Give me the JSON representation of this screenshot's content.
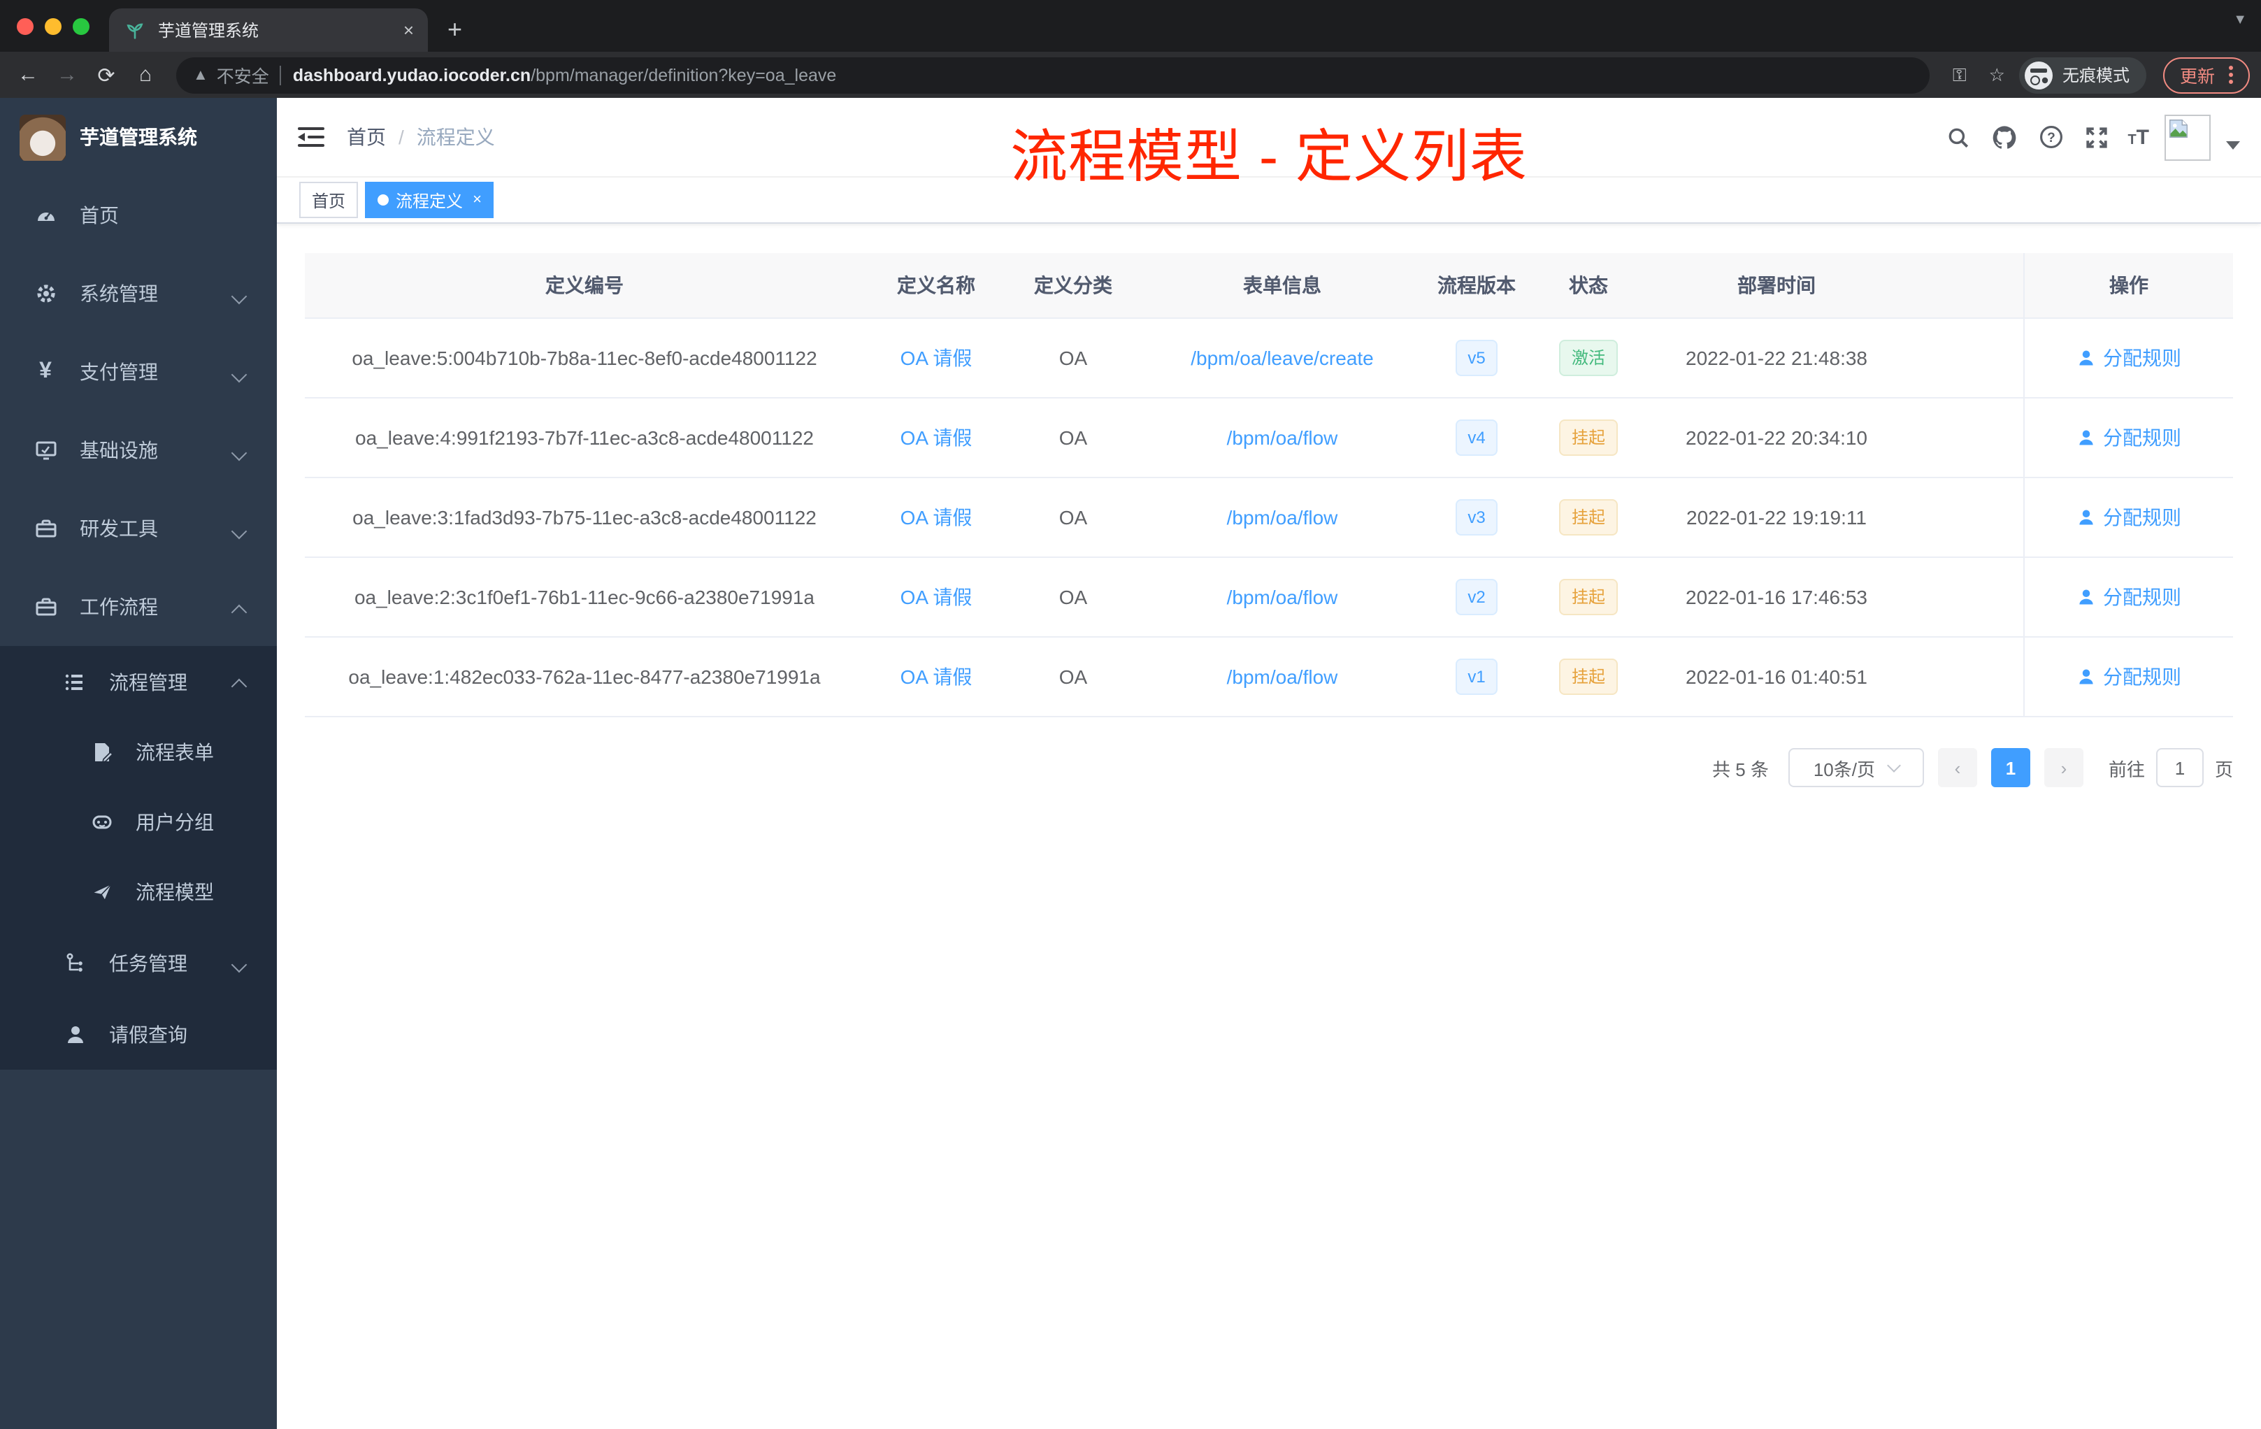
{
  "browser": {
    "tab": {
      "title": "芋道管理系统",
      "close": "×",
      "new_tab": "+"
    },
    "address": {
      "not_secure": "不安全",
      "domain": "dashboard.yudao.iocoder.cn",
      "path": "/bpm/manager/definition?key=oa_leave"
    },
    "incognito_label": "无痕模式",
    "update_label": "更新"
  },
  "sidebar": {
    "logo_title": "芋道管理系统",
    "menu": [
      {
        "label": "首页",
        "icon": "dashboard"
      },
      {
        "label": "系统管理",
        "icon": "gear"
      },
      {
        "label": "支付管理",
        "icon": "yen"
      },
      {
        "label": "基础设施",
        "icon": "monitor"
      },
      {
        "label": "研发工具",
        "icon": "toolbox"
      },
      {
        "label": "工作流程",
        "icon": "toolbox"
      }
    ],
    "workflow_submenu": [
      {
        "label": "流程管理",
        "icon": "list"
      },
      {
        "label": "流程表单",
        "icon": "form"
      },
      {
        "label": "用户分组",
        "icon": "robot"
      },
      {
        "label": "流程模型",
        "icon": "send"
      },
      {
        "label": "任务管理",
        "icon": "tree"
      },
      {
        "label": "请假查询",
        "icon": "user"
      }
    ]
  },
  "header": {
    "breadcrumb_home": "首页",
    "breadcrumb_sep": "/",
    "breadcrumb_current": "流程定义",
    "annotation": "流程模型 - 定义列表"
  },
  "tags": {
    "home": "首页",
    "active": "流程定义",
    "close": "×"
  },
  "table": {
    "columns": [
      "定义编号",
      "定义名称",
      "定义分类",
      "表单信息",
      "流程版本",
      "状态",
      "部署时间",
      "操作"
    ],
    "rows": [
      {
        "id": "oa_leave:5:004b710b-7b8a-11ec-8ef0-acde48001122",
        "name": "OA 请假",
        "category": "OA",
        "form": "/bpm/oa/leave/create",
        "version": "v5",
        "status": "激活",
        "time": "2022-01-22 21:48:38",
        "action": "分配规则"
      },
      {
        "id": "oa_leave:4:991f2193-7b7f-11ec-a3c8-acde48001122",
        "name": "OA 请假",
        "category": "OA",
        "form": "/bpm/oa/flow",
        "version": "v4",
        "status": "挂起",
        "time": "2022-01-22 20:34:10",
        "action": "分配规则"
      },
      {
        "id": "oa_leave:3:1fad3d93-7b75-11ec-a3c8-acde48001122",
        "name": "OA 请假",
        "category": "OA",
        "form": "/bpm/oa/flow",
        "version": "v3",
        "status": "挂起",
        "time": "2022-01-22 19:19:11",
        "action": "分配规则"
      },
      {
        "id": "oa_leave:2:3c1f0ef1-76b1-11ec-9c66-a2380e71991a",
        "name": "OA 请假",
        "category": "OA",
        "form": "/bpm/oa/flow",
        "version": "v2",
        "status": "挂起",
        "time": "2022-01-16 17:46:53",
        "action": "分配规则"
      },
      {
        "id": "oa_leave:1:482ec033-762a-11ec-8477-a2380e71991a",
        "name": "OA 请假",
        "category": "OA",
        "form": "/bpm/oa/flow",
        "version": "v1",
        "status": "挂起",
        "time": "2022-01-16 01:40:51",
        "action": "分配规则"
      }
    ]
  },
  "pagination": {
    "total": "共 5 条",
    "page_size": "10条/页",
    "current_page": "1",
    "prev": "‹",
    "next": "›",
    "goto": "前往",
    "page_unit": "页",
    "goto_value": "1"
  },
  "colors": {
    "primary": "#409eff",
    "success_text": "#42b97c",
    "warning_text": "#e6a23c",
    "annotation_red": "#ff2600",
    "sidebar_bg": "#2d3a4b",
    "submenu_bg": "#202b3b"
  }
}
